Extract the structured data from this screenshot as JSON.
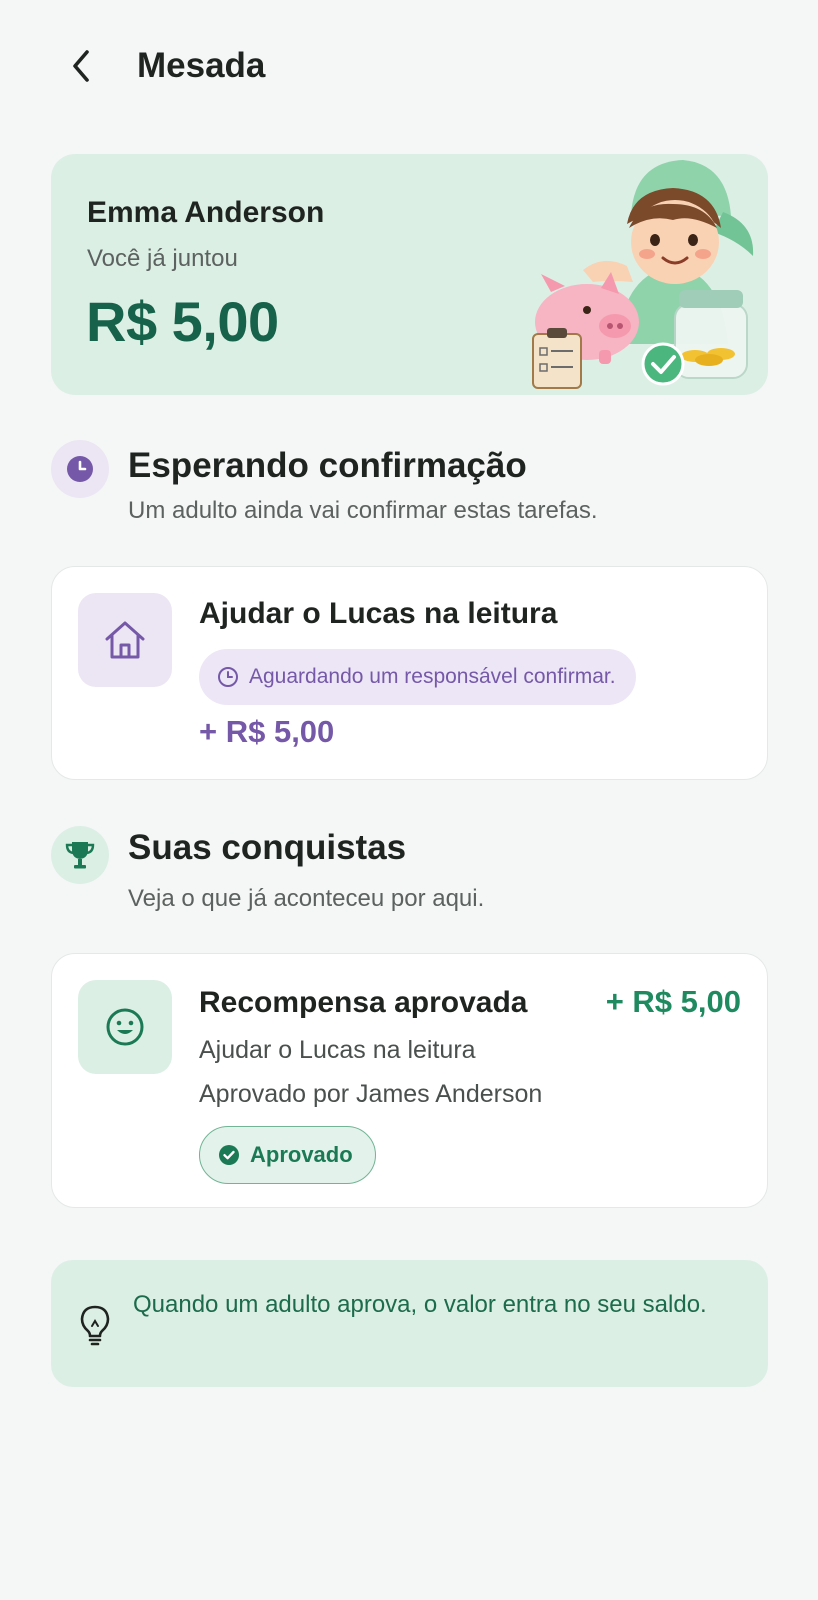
{
  "header": {
    "title": "Mesada",
    "back_icon": "chevron-left-icon"
  },
  "hero": {
    "name": "Emma Anderson",
    "subtitle": "Você já juntou",
    "amount": "R$ 5,00",
    "illustration": "kid-piggy-bank-illustration"
  },
  "pending_section": {
    "icon": "clock-icon",
    "title": "Esperando confirmação",
    "description": "Um adulto ainda vai confirmar estas tarefas.",
    "items": [
      {
        "icon": "house-icon",
        "title": "Ajudar o Lucas na leitura",
        "status": "Aguardando um responsável confirmar.",
        "amount": "+ R$ 5,00"
      }
    ]
  },
  "achievements_section": {
    "icon": "trophy-icon",
    "title": "Suas conquistas",
    "description": "Veja o que já aconteceu por aqui.",
    "items": [
      {
        "icon": "smiley-icon",
        "title": "Recompensa aprovada",
        "amount": "+ R$ 5,00",
        "task": "Ajudar o Lucas na leitura",
        "approved_by": "Aprovado por James Anderson",
        "badge": "Aprovado"
      }
    ]
  },
  "tip": {
    "icon": "lightbulb-icon",
    "text": "Quando um adulto aprova, o valor entra no seu saldo."
  },
  "colors": {
    "background": "#f5f7f6",
    "primary_green": "#17624a",
    "accent_green": "#1f8a5f",
    "mint_surface": "#dcefe5",
    "purple": "#7559a8",
    "lavender_surface": "#ede6f6"
  }
}
